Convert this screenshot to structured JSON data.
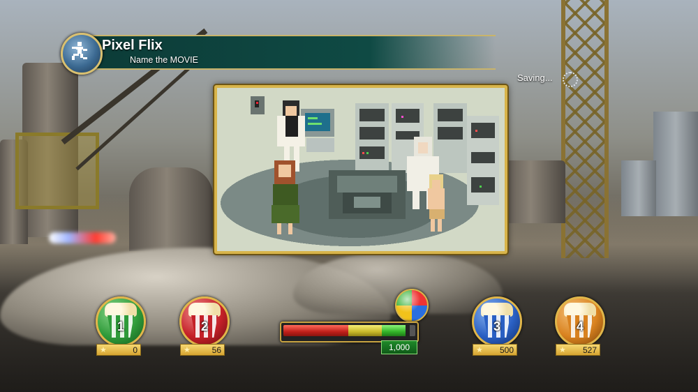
{
  "header": {
    "title": "Pixel Flix",
    "subtitle": "Name the MOVIE",
    "logo_icon": "running-pixel-man-icon"
  },
  "status": {
    "saving_text": "Saving..."
  },
  "round": {
    "points_value": "1,000",
    "timer_remaining": 0.93,
    "timer_colors": [
      "#d0261f",
      "#d6c72d",
      "#3cc331"
    ]
  },
  "players": [
    {
      "number": "1",
      "score": "0",
      "color": "#2f9b3a"
    },
    {
      "number": "2",
      "score": "56",
      "color": "#c42128"
    },
    {
      "number": "3",
      "score": "500",
      "color": "#2a60c4"
    },
    {
      "number": "4",
      "score": "527",
      "color": "#d9821f"
    }
  ],
  "colors": {
    "banner": "#0f4a44",
    "gold_border": "#d8b44a"
  }
}
